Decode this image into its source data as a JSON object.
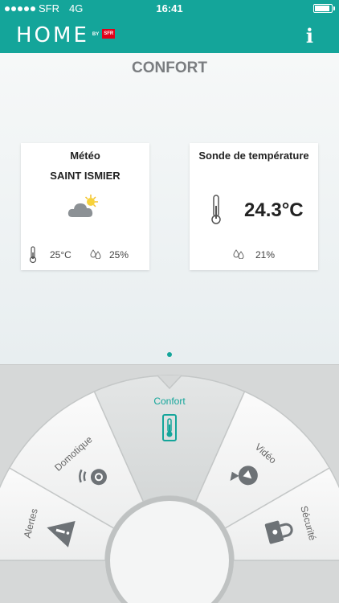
{
  "status_bar": {
    "carrier": "SFR",
    "network": "4G",
    "time": "16:41",
    "battery_level": 0.95
  },
  "header": {
    "logo_text": "HOME",
    "logo_by": "BY",
    "logo_brand": "SFR",
    "info_icon": "info-icon"
  },
  "page": {
    "title": "CONFORT"
  },
  "meteo_card": {
    "title": "Météo",
    "city": "SAINT ISMIER",
    "weather_icon": "partly-cloudy-icon",
    "temperature": "25°C",
    "humidity": "25%"
  },
  "sonde_card": {
    "title": "Sonde de température",
    "temperature": "24.3°C",
    "humidity": "21%"
  },
  "menu": {
    "items": [
      {
        "label": "Alertes",
        "icon": "alert-icon",
        "active": false
      },
      {
        "label": "Domotique",
        "icon": "remote-control-icon",
        "active": false
      },
      {
        "label": "Confort",
        "icon": "thermometer-icon",
        "active": true
      },
      {
        "label": "Vidéo",
        "icon": "camera-icon",
        "active": false
      },
      {
        "label": "Sécurité",
        "icon": "lock-icon",
        "active": false
      }
    ]
  },
  "colors": {
    "accent": "#14a59a",
    "title_gray": "#7a7d80",
    "menu_bg": "#d6d8d8"
  }
}
